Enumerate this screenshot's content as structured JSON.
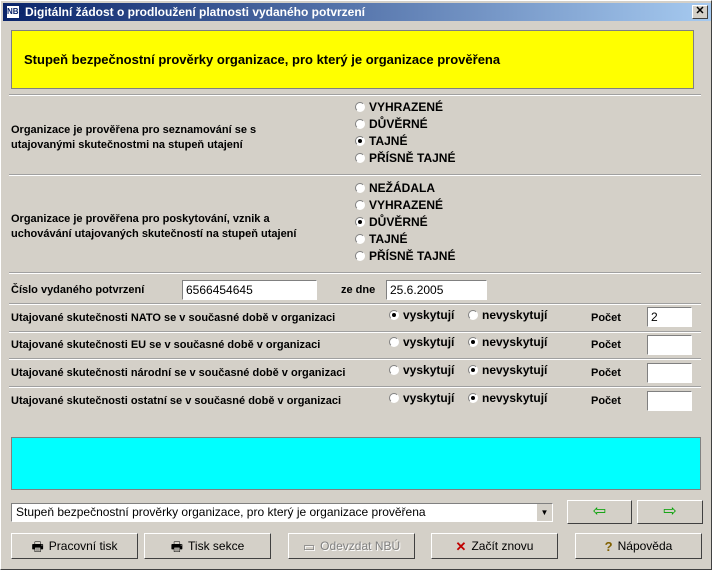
{
  "window": {
    "title": "Digitální žádost o prodloužení platnosti vydaného potvrzení",
    "close": "✕"
  },
  "banner": {
    "text": "Stupeň bezpečnostní prověrky organizace, pro který je organizace prověřena"
  },
  "section1": {
    "label_line1": "Organizace je prověřena pro seznamování se s",
    "label_line2": "utajovanými skutečnostmi na stupeň utajení",
    "options": [
      "VYHRAZENÉ",
      "DŮVĚRNÉ",
      "TAJNÉ",
      "PŘÍSNĚ TAJNÉ"
    ],
    "selected": "TAJNÉ"
  },
  "section2": {
    "label_line1": "Organizace je prověřena pro poskytování, vznik a",
    "label_line2": "uchovávání utajovaných skutečností na stupeň utajení",
    "options": [
      "NEŽÁDALA",
      "VYHRAZENÉ",
      "DŮVĚRNÉ",
      "TAJNÉ",
      "PŘÍSNĚ TAJNÉ"
    ],
    "selected": "DŮVĚRNÉ"
  },
  "certificate": {
    "number_label": "Číslo vydaného potvrzení",
    "number_value": "6566454645",
    "date_label": "ze dne",
    "date_value": "25.6.2005"
  },
  "facts": {
    "yes_label": "vyskytují",
    "no_label": "nevyskytují",
    "count_label": "Počet",
    "rows": [
      {
        "label": "Utajované skutečnosti NATO se v současné době v organizaci",
        "selected": "yes",
        "count": "2"
      },
      {
        "label": "Utajované skutečnosti EU se v současné době v organizaci",
        "selected": "no",
        "count": ""
      },
      {
        "label": "Utajované skutečnosti národní se v současné době v organizaci",
        "selected": "no",
        "count": ""
      },
      {
        "label": "Utajované skutečnosti ostatní se v současné době v organizaci",
        "selected": "no",
        "count": ""
      }
    ]
  },
  "navigation": {
    "selected_section": "Stupeň bezpečnostní prověrky organizace, pro který je organizace prověřena"
  },
  "buttons": {
    "print_work": "Pracovní tisk",
    "print_section": "Tisk sekce",
    "submit_nbu": "Odevzdat NBÚ",
    "restart": "Začít znovu",
    "help": "Nápověda"
  },
  "icons": {
    "printer": "printer-icon",
    "submit": "submit-icon",
    "restart": "x-icon",
    "help": "help-icon",
    "prev": "arrow-left-icon",
    "next": "arrow-right-icon"
  }
}
